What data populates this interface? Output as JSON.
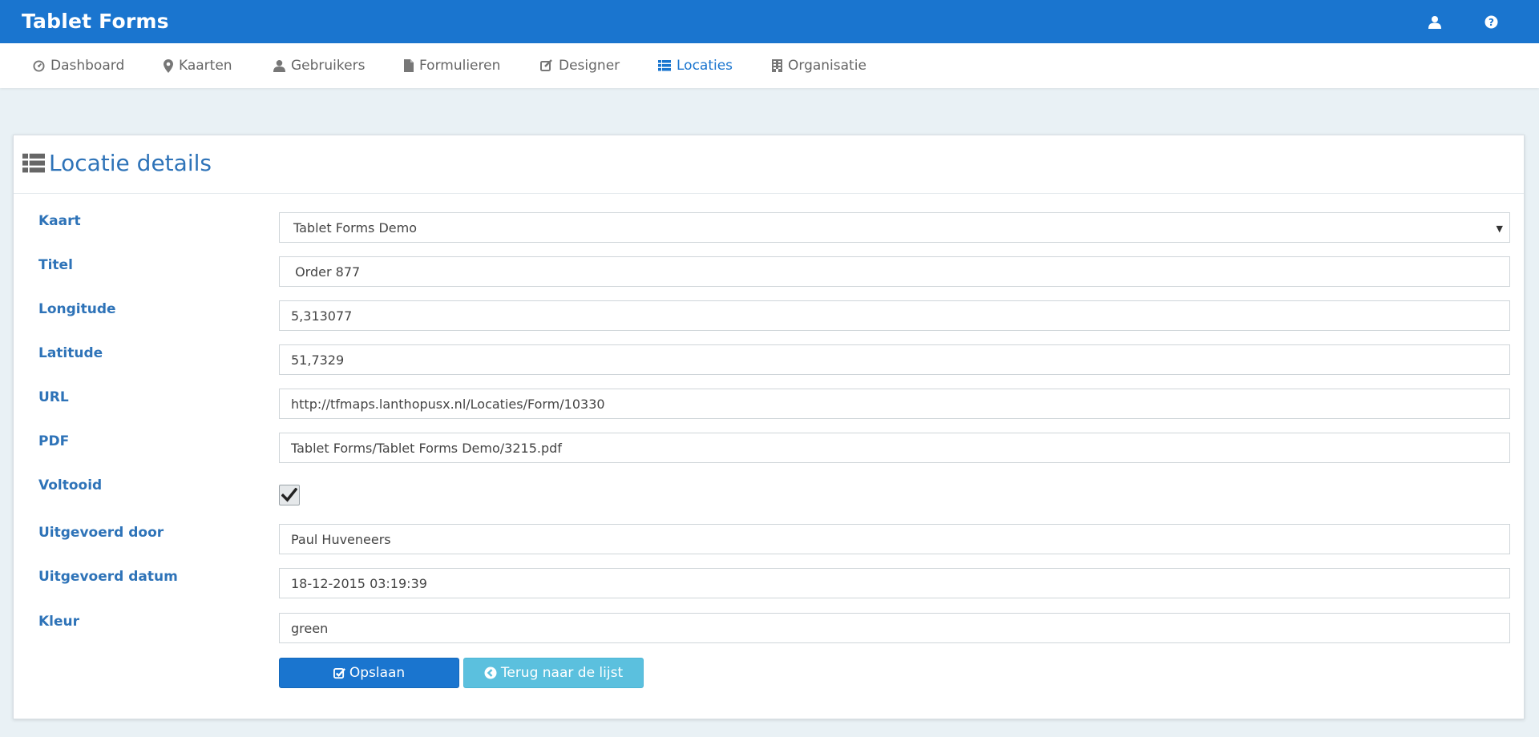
{
  "app": {
    "title": "Tablet Forms"
  },
  "topbar": {
    "icons": [
      "user-icon",
      "help-icon"
    ]
  },
  "nav": {
    "items": [
      {
        "label": "Dashboard",
        "icon": "dashboard-icon"
      },
      {
        "label": "Kaarten",
        "icon": "map-marker-icon"
      },
      {
        "label": "Gebruikers",
        "icon": "user-icon"
      },
      {
        "label": "Formulieren",
        "icon": "file-icon"
      },
      {
        "label": "Designer",
        "icon": "edit-icon"
      },
      {
        "label": "Locaties",
        "icon": "list-icon",
        "active": true
      },
      {
        "label": "Organisatie",
        "icon": "building-icon"
      }
    ]
  },
  "panel": {
    "title": "Locatie details",
    "icon": "list-icon"
  },
  "form": {
    "kaart": {
      "label": "Kaart",
      "value": "Tablet Forms Demo"
    },
    "titel": {
      "label": "Titel",
      "value": " Order 877"
    },
    "longitude": {
      "label": "Longitude",
      "value": "5,313077"
    },
    "latitude": {
      "label": "Latitude",
      "value": "51,7329"
    },
    "url": {
      "label": "URL",
      "value": "http://tfmaps.lanthopusx.nl/Locaties/Form/10330"
    },
    "pdf": {
      "label": "PDF",
      "value": "Tablet Forms/Tablet Forms Demo/3215.pdf"
    },
    "voltooid": {
      "label": "Voltooid",
      "checked": true
    },
    "uitgevoerd_door": {
      "label": "Uitgevoerd door",
      "value": "Paul Huveneers"
    },
    "uitgevoerd_datum": {
      "label": "Uitgevoerd datum",
      "value": "18-12-2015 03:19:39"
    },
    "kleur": {
      "label": "Kleur",
      "value": "green"
    }
  },
  "buttons": {
    "save_label": "Opslaan",
    "back_label": "Terug naar de lijst"
  },
  "colors": {
    "primary": "#1a75cf",
    "info": "#5bc0de",
    "label": "#2e73b8"
  }
}
